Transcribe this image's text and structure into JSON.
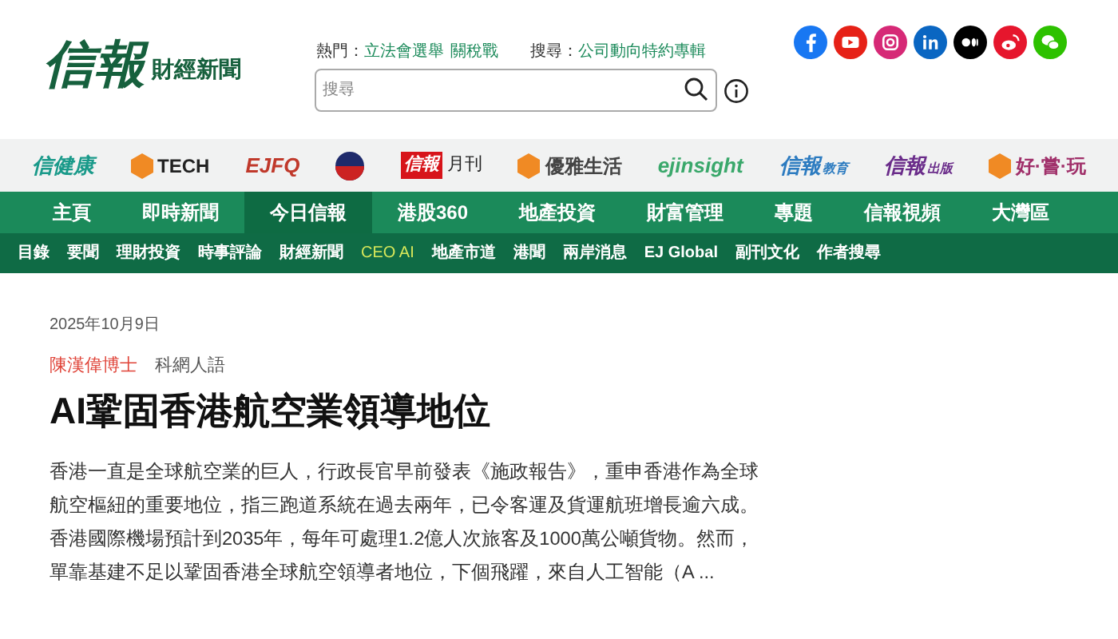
{
  "header": {
    "logo": "信報",
    "logo_sub": "財經新聞",
    "hot_label": "熱門：",
    "hot_links": [
      "立法會選舉",
      "關稅戰"
    ],
    "search_label": "搜尋：",
    "search_links": [
      "公司動向特約專輯"
    ],
    "search": {
      "placeholder": "搜尋"
    },
    "social": [
      {
        "kind": "facebook",
        "color": "#1877f2"
      },
      {
        "kind": "youtube",
        "color": "#e62117"
      },
      {
        "kind": "instagram",
        "color": "#d62976"
      },
      {
        "kind": "linkedin",
        "color": "#0a66c2"
      },
      {
        "kind": "medium",
        "color": "#000000"
      },
      {
        "kind": "weibo",
        "color": "#e6162d"
      },
      {
        "kind": "wechat",
        "color": "#2dc100"
      }
    ]
  },
  "brands": [
    {
      "kind": "text",
      "label": "信健康",
      "color": "#1a9a8a"
    },
    {
      "kind": "icon",
      "label": "TECH",
      "color": "#222222"
    },
    {
      "kind": "text",
      "label": "EJFQ",
      "color": "#c0392b"
    },
    {
      "kind": "badge",
      "color": "#1e2a6b"
    },
    {
      "kind": "box",
      "label": "信報",
      "sub": "月刊",
      "color": "#d7141a"
    },
    {
      "kind": "icon",
      "label": "優雅生活",
      "color": "#444444"
    },
    {
      "kind": "text",
      "label": "ejinsight",
      "color": "#3aa86b"
    },
    {
      "kind": "text",
      "label": "信報",
      "sub": "教育",
      "color": "#2c7bc0"
    },
    {
      "kind": "text",
      "label": "信報",
      "sub": "出版",
      "color": "#6a2c8a"
    },
    {
      "kind": "icon",
      "label": "好·嘗·玩",
      "color": "#a0306a"
    }
  ],
  "main_nav": [
    {
      "label": "主頁",
      "selected": false
    },
    {
      "label": "即時新聞",
      "selected": false
    },
    {
      "label": "今日信報",
      "selected": true
    },
    {
      "label": "港股360",
      "selected": false
    },
    {
      "label": "地產投資",
      "selected": false
    },
    {
      "label": "財富管理",
      "selected": false
    },
    {
      "label": "專題",
      "selected": false
    },
    {
      "label": "信報視頻",
      "selected": false
    },
    {
      "label": "大灣區",
      "selected": false
    }
  ],
  "sub_nav": [
    {
      "label": "目錄",
      "highlighted": false
    },
    {
      "label": "要聞",
      "highlighted": false
    },
    {
      "label": "理財投資",
      "highlighted": false
    },
    {
      "label": "時事評論",
      "highlighted": false
    },
    {
      "label": "財經新聞",
      "highlighted": false
    },
    {
      "label": "CEO AI",
      "highlighted": true
    },
    {
      "label": "地產市道",
      "highlighted": false
    },
    {
      "label": "港聞",
      "highlighted": false
    },
    {
      "label": "兩岸消息",
      "highlighted": false
    },
    {
      "label": "EJ Global",
      "highlighted": false
    },
    {
      "label": "副刊文化",
      "highlighted": false
    },
    {
      "label": "作者搜尋",
      "highlighted": false
    }
  ],
  "article": {
    "date": "2025年10月9日",
    "author": "陳漢偉博士",
    "column": "科網人語",
    "title": "AI鞏固香港航空業領導地位",
    "body": "香港一直是全球航空業的巨人，行政長官早前發表《施政報告》，重申香港作為全球航空樞紐的重要地位，指三跑道系統在過去兩年，已令客運及貨運航班增長逾六成。香港國際機場預計到2035年，每年可處理1.2億人次旅客及1000萬公噸貨物。然而，單靠基建不足以鞏固香港全球航空領導者地位，下個飛躍，來自人工智能（A ..."
  }
}
